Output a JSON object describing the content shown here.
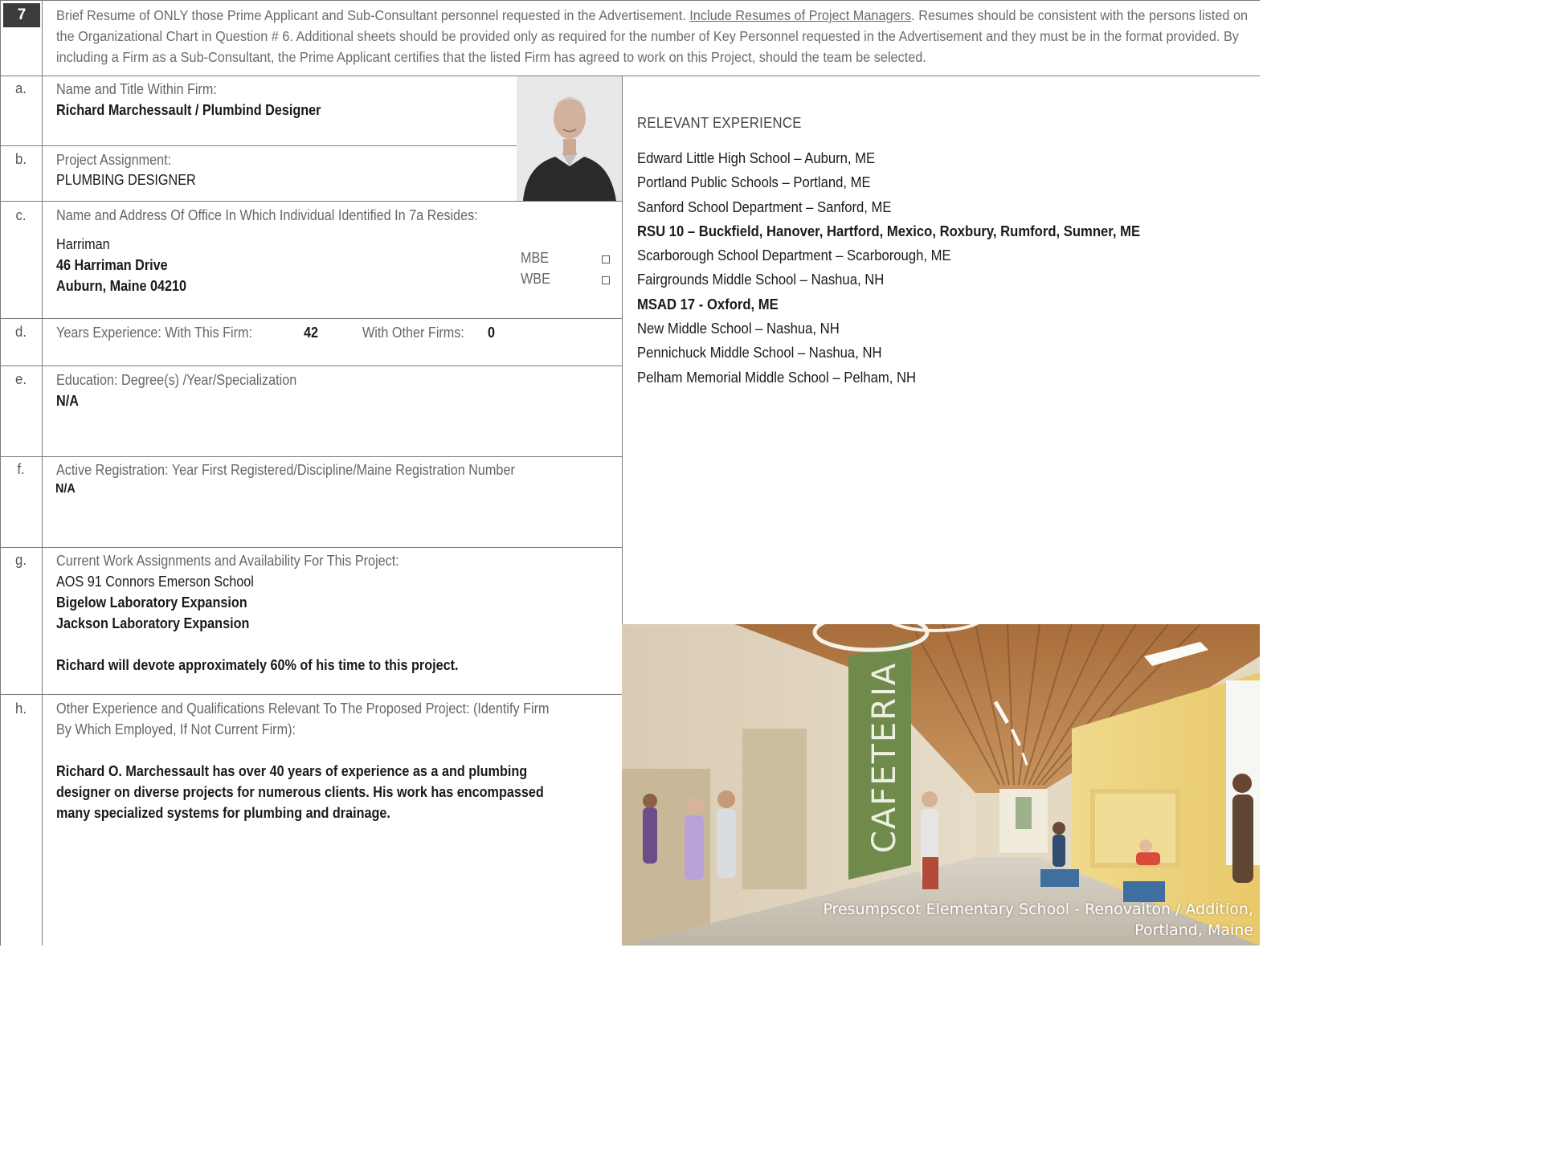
{
  "section": {
    "number": "7",
    "intro_part1": "Brief Resume of ONLY those Prime Applicant and Sub-Consultant personnel requested in the Advertisement. ",
    "intro_link": "Include Resumes of Project Managers",
    "intro_part2": ". Resumes should be consistent with the persons listed on the Organizational Chart in Question # 6. Additional sheets should be provided only as required for the number of Key Personnel requested in the Advertisement and they must be in the format provided. By including a Firm as a Sub-Consultant, the Prime Applicant certifies that the listed Firm has agreed to work on this Project, should the team be selected."
  },
  "a": {
    "letter": "a.",
    "label": "Name and Title Within Firm:",
    "value": "Richard Marchessault / Plumbind Designer"
  },
  "b": {
    "letter": "b.",
    "label": "Project Assignment:",
    "value": "PLUMBING DESIGNER"
  },
  "c": {
    "letter": "c.",
    "label": "Name and Address Of Office In Which Individual Identified In 7a Resides:",
    "office": "Harriman",
    "street": "46 Harriman Drive",
    "city": "Auburn, Maine 04210",
    "mbe": "MBE",
    "wbe": "WBE"
  },
  "d": {
    "letter": "d.",
    "label_firm": "Years Experience:  With This Firm:",
    "years_firm": "42",
    "label_other": "With Other Firms:",
    "years_other": "0"
  },
  "e": {
    "letter": "e.",
    "label": "Education:  Degree(s) /Year/Specialization",
    "value": "N/A"
  },
  "f": {
    "letter": "f.",
    "label": "Active Registration:  Year First Registered/Discipline/Maine Registration Number",
    "value": "N/A"
  },
  "g": {
    "letter": "g.",
    "label": "Current Work Assignments and Availability For This Project:",
    "items": [
      "AOS 91 Connors Emerson School",
      "Bigelow Laboratory Expansion",
      "Jackson Laboratory Expansion"
    ],
    "availability": "Richard will devote approximately 60% of his time to this project."
  },
  "h": {
    "letter": "h.",
    "label_line1": "Other Experience and Qualifications Relevant To The Proposed Project: (Identify Firm",
    "label_line2": "By Which Employed, If Not Current Firm):",
    "text_line1": "Richard O. Marchessault has over 40 years of experience as a and plumbing",
    "text_line2": "designer on diverse projects for numerous clients. His work has encompassed",
    "text_line3": "many specialized systems for plumbing and drainage."
  },
  "relevant": {
    "title": "RELEVANT EXPERIENCE",
    "items": [
      "Edward Little High School – Auburn, ME",
      "Portland Public Schools – Portland, ME",
      "Sanford School Department – Sanford, ME",
      "RSU 10 – Buckfield, Hanover, Hartford, Mexico, Roxbury, Rumford, Sumner, ME",
      "Scarborough School Department – Scarborough, ME",
      "Fairgrounds Middle School – Nashua, NH",
      "MSAD 17 - Oxford, ME",
      "New Middle School – Nashua, NH",
      "Pennichuck Middle School – Nashua, NH",
      "Pelham Memorial Middle School – Pelham, NH"
    ]
  },
  "render": {
    "sign": "CAFETERIA",
    "caption_line1": "Presumpscot Elementary School - Renovaiton / Addition,",
    "caption_line2": "Portland, Maine"
  }
}
